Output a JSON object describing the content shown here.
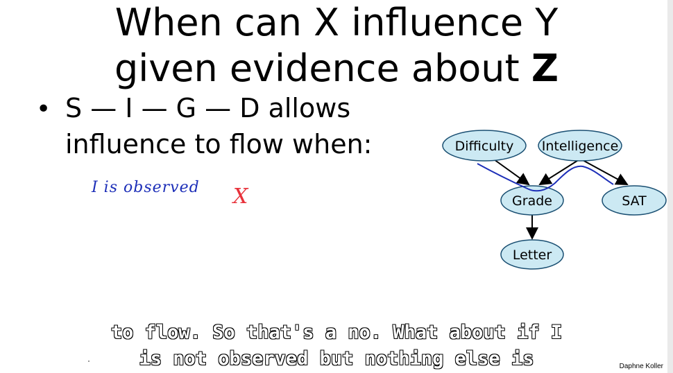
{
  "title": {
    "line1": "When can X influence Y",
    "line2_prefix": "given evidence about ",
    "line2_bold": "Z"
  },
  "bullet": {
    "line1": "S — I — G — D allows",
    "line2": "influence to flow when:"
  },
  "handwriting": {
    "note": "I is observed",
    "mark": "X",
    "note_color": "#1d2fb8",
    "mark_color": "#e8313a"
  },
  "graph": {
    "nodes": {
      "difficulty": "Difficulty",
      "intelligence": "Intelligence",
      "grade": "Grade",
      "sat": "SAT",
      "letter": "Letter"
    },
    "node_fill": "#cce9f3",
    "trail_color": "#1d2fb8"
  },
  "subtitles": {
    "line1": "to flow. So that's a no. What about if I",
    "line2": "is not observed but nothing else is"
  },
  "credit": "Daphne Koller"
}
